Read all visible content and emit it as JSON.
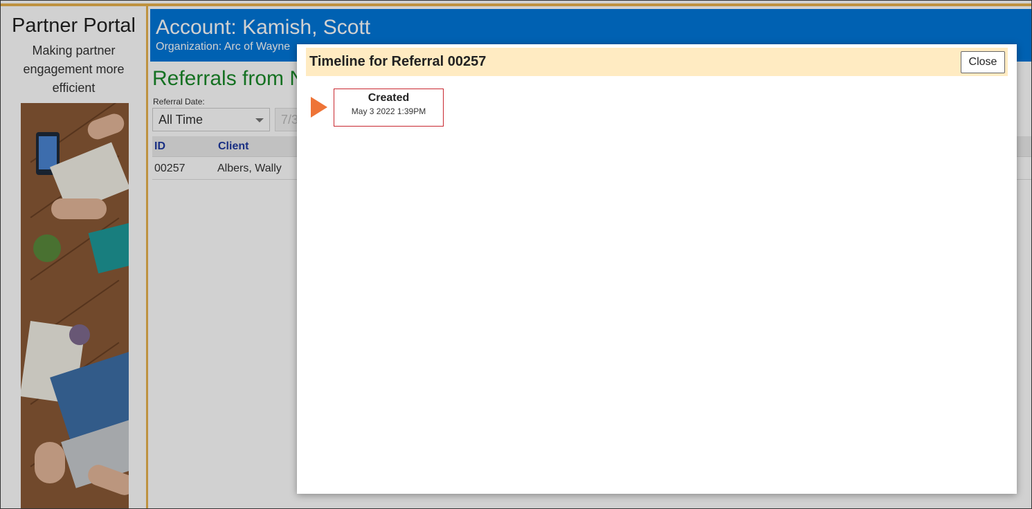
{
  "sidebar": {
    "title": "Partner Portal",
    "tagline": "Making partner engagement more efficient"
  },
  "account": {
    "title": "Account: Kamish, Scott",
    "organization": "Organization: Arc of Wayne"
  },
  "page": {
    "heading": "Referrals from N"
  },
  "filters": {
    "date_label": "Referral Date:",
    "date_value": "All Time",
    "date_input_value": "7/3"
  },
  "grid": {
    "columns": [
      "ID",
      "Client"
    ],
    "rows": [
      {
        "id": "00257",
        "client": "Albers, Wally"
      }
    ]
  },
  "dialog": {
    "title": "Timeline for Referral 00257",
    "close_label": "Close",
    "events": [
      {
        "label": "Created",
        "time": "May 3 2022 1:39PM"
      }
    ]
  },
  "colors": {
    "accent_gold": "#e8b24f",
    "account_bar": "#0077d9",
    "heading_green": "#1a8a2a",
    "dialog_header": "#ffebc2",
    "timeline_arrow": "#ee7437",
    "event_border": "#c8272f"
  }
}
